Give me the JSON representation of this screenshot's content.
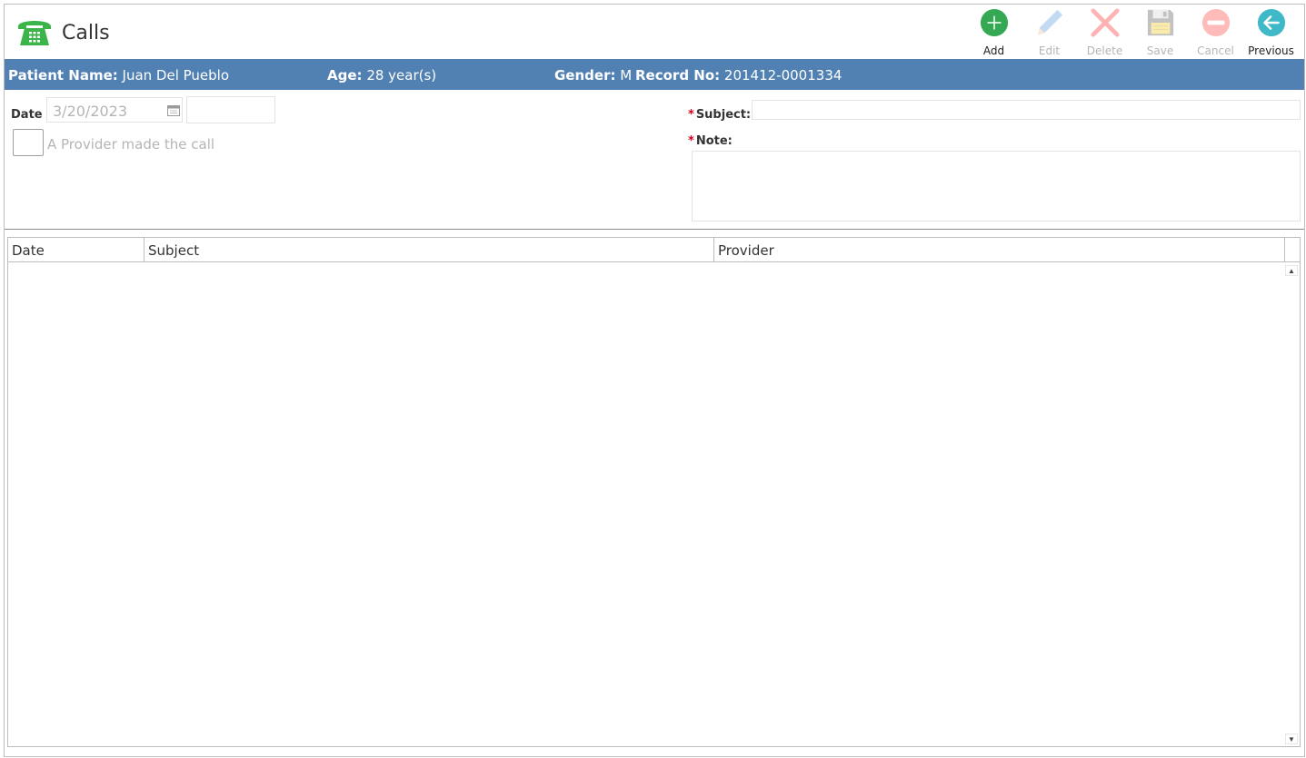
{
  "app": {
    "title": "Calls"
  },
  "toolbar": {
    "add": "Add",
    "edit": "Edit",
    "delete": "Delete",
    "save": "Save",
    "cancel": "Cancel",
    "previous": "Previous"
  },
  "patient": {
    "name_label": "Patient Name:",
    "name": "Juan Del Pueblo",
    "age_label": "Age:",
    "age": "28 year(s)",
    "gender_label": "Gender:",
    "gender": "M",
    "record_label": "Record No:",
    "record": "201412-0001334"
  },
  "form": {
    "date_label": "Date",
    "date_value": "3/20/2023",
    "provider_call_label": "A Provider made the call",
    "subject_label": "Subject:",
    "note_label": "Note:",
    "required_mark": "*"
  },
  "grid": {
    "columns": [
      "Date",
      "Subject",
      "Provider"
    ],
    "rows": []
  },
  "colors": {
    "patient_bar": "#5180b3",
    "add": "#34a853",
    "previous": "#3fb8c8",
    "required": "#d9001b"
  }
}
